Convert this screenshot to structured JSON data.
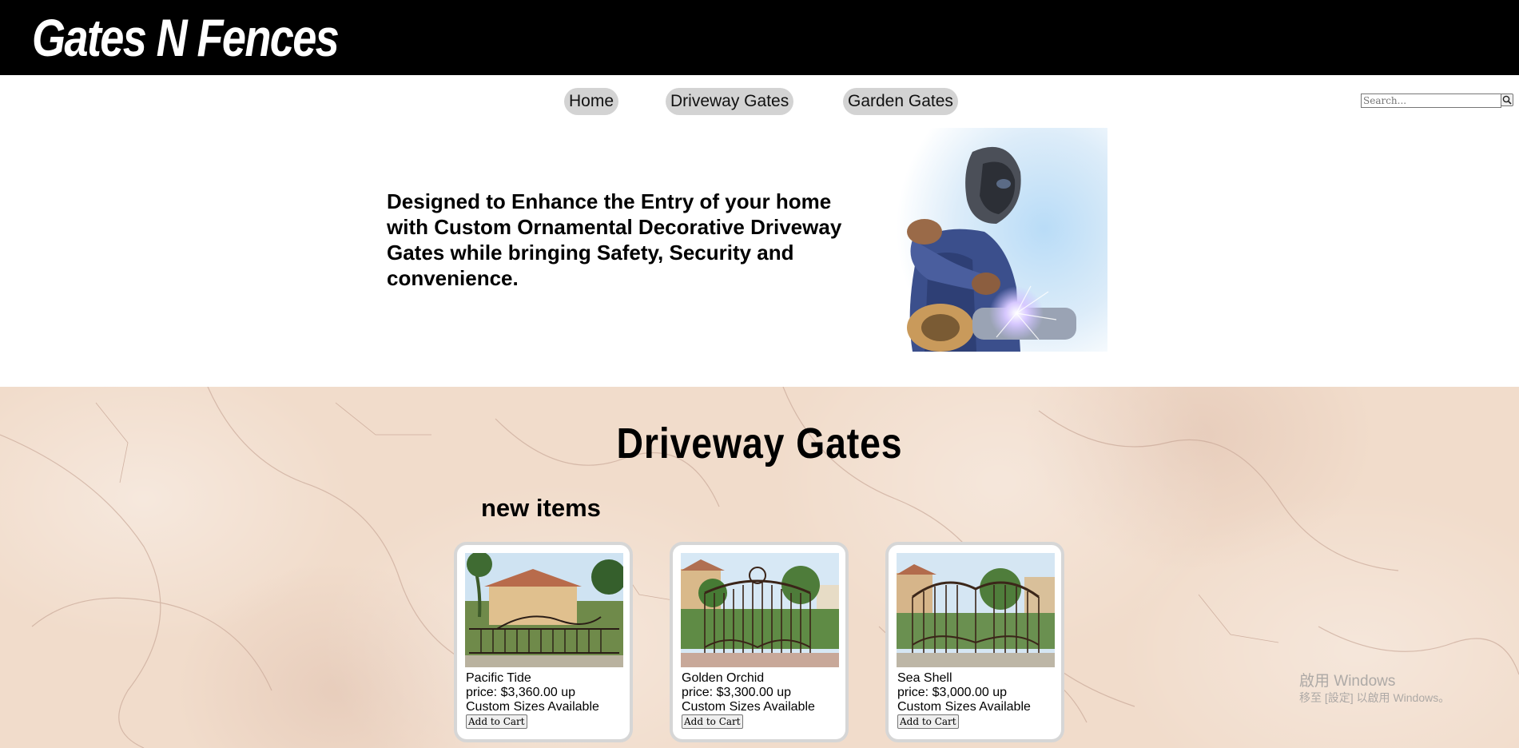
{
  "header": {
    "brand": "Gates N Fences"
  },
  "nav": {
    "items": [
      {
        "label": "Home"
      },
      {
        "label": "Driveway Gates"
      },
      {
        "label": "Garden Gates"
      }
    ]
  },
  "search": {
    "placeholder": "Search...",
    "icon": "search-icon"
  },
  "hero": {
    "text": "Designed to Enhance the Entry of your home with Custom Ornamental Decorative Driveway Gates while bringing Safety, Security and convenience.",
    "image": "welder-photo"
  },
  "section": {
    "title": "Driveway Gates",
    "subtitle": "new items"
  },
  "products": [
    {
      "name": "Pacific Tide",
      "price": "price: $3,360.00 up",
      "note": "Custom Sizes Available",
      "button": "Add to Cart"
    },
    {
      "name": "Golden Orchid",
      "price": "price: $3,300.00 up",
      "note": "Custom Sizes Available",
      "button": "Add to Cart"
    },
    {
      "name": "Sea Shell",
      "price": "price: $3,000.00 up",
      "note": "Custom Sizes Available",
      "button": "Add to Cart"
    }
  ],
  "watermark": {
    "line1": "啟用 Windows",
    "line2": "移至 [設定] 以啟用 Windows。"
  },
  "colors": {
    "header_bg": "#000000",
    "nav_pill": "#d3d3d3",
    "marble": "#f1dccb"
  }
}
